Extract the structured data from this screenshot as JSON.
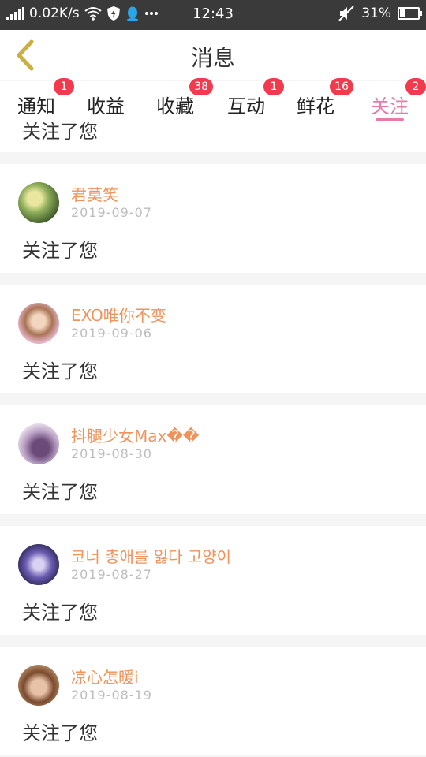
{
  "status_bar": {
    "speed": "0.02K/s",
    "time": "12:43",
    "battery": "31%",
    "battery_level": 0.31,
    "icons": [
      "signal-icon",
      "wifi-icon",
      "shield-icon",
      "qq-penguin-icon",
      "more-dots-icon",
      "mute-icon",
      "battery-icon"
    ]
  },
  "header": {
    "title": "消息",
    "back_icon": "chevron-left-icon"
  },
  "tabs": [
    {
      "label": "通知",
      "badge": "1"
    },
    {
      "label": "收益",
      "badge": ""
    },
    {
      "label": "收藏",
      "badge": "38"
    },
    {
      "label": "互动",
      "badge": "1"
    },
    {
      "label": "鲜花",
      "badge": "16"
    },
    {
      "label": "关注",
      "badge": "2",
      "active": true
    }
  ],
  "list": {
    "partial_message": "关注了您",
    "items": [
      {
        "name": "君莫笑",
        "date": "2019-09-07",
        "message": "关注了您"
      },
      {
        "name": "EXO唯你不变",
        "date": "2019-09-06",
        "message": "关注了您"
      },
      {
        "name": "抖腿少女Max��",
        "date": "2019-08-30",
        "message": "关注了您"
      },
      {
        "name": "코너 총애를 잃다 고양이",
        "date": "2019-08-27",
        "message": "关注了您"
      },
      {
        "name": "凉心怎暖i",
        "date": "2019-08-19",
        "message": "关注了您"
      }
    ]
  },
  "colors": {
    "accent": "#e87aa9",
    "username": "#f0925a",
    "badge": "#f23a4f",
    "back_arrow": "#c9b040"
  }
}
